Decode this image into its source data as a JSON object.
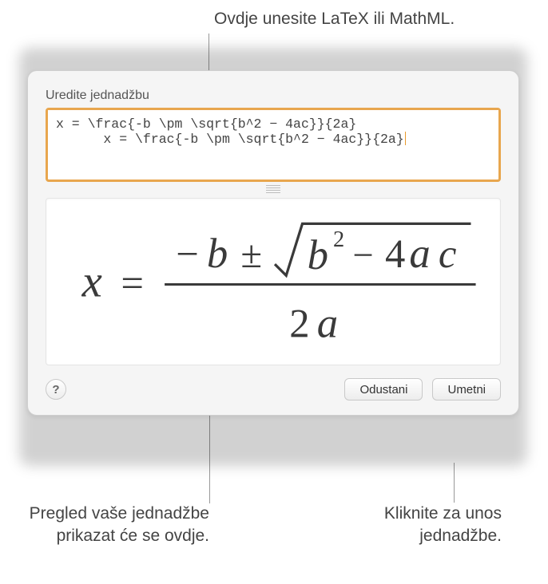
{
  "callouts": {
    "top": "Ovdje unesite LaTeX ili MathML.",
    "left": "Pregled vaše jednadžbe prikazat će se ovdje.",
    "right": "Kliknite za unos jednadžbe."
  },
  "dialog": {
    "label": "Uredite jednadžbu",
    "input_value": "x = \\frac{-b \\pm \\sqrt{b^2 − 4ac}}{2a}",
    "preview_formula": "x = (−b ± √(b² − 4ac)) / 2a",
    "help_label": "?",
    "cancel_label": "Odustani",
    "insert_label": "Umetni"
  }
}
